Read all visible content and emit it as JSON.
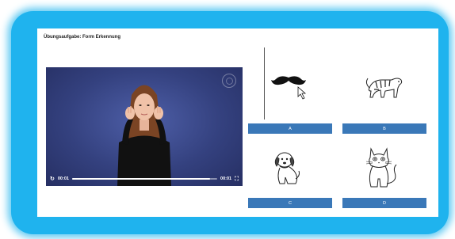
{
  "page": {
    "title": "Übungsaufgabe: Form Erkennung"
  },
  "video": {
    "current_time": "00:01",
    "duration": "00:01",
    "progress": 0.95
  },
  "answers": [
    {
      "label": "A",
      "image": "mustache"
    },
    {
      "label": "B",
      "image": "tiger"
    },
    {
      "label": "C",
      "image": "dog"
    },
    {
      "label": "D",
      "image": "cat"
    }
  ],
  "colors": {
    "frame": "#1fb3ee",
    "button": "#3a78b8",
    "video_bg": "#34417f"
  }
}
